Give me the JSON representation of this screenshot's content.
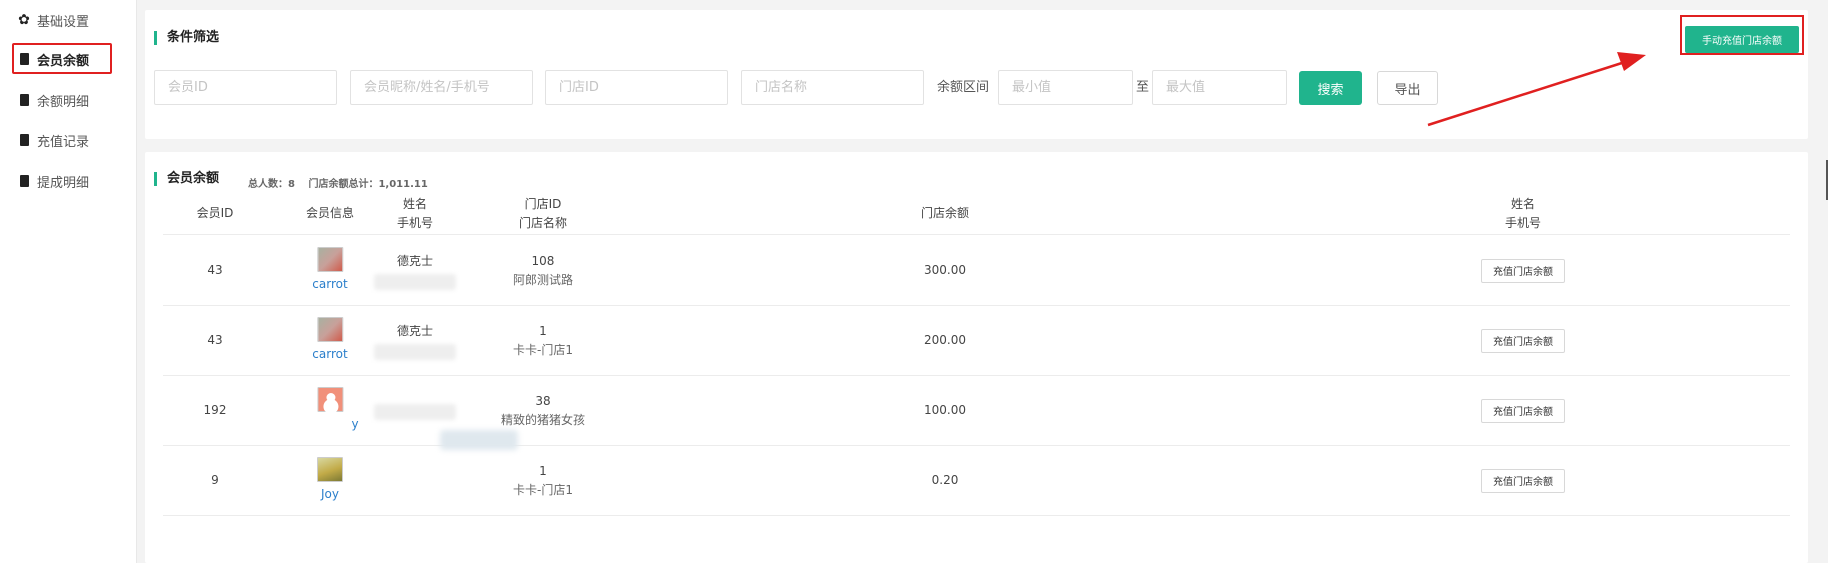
{
  "sidebar": {
    "items": [
      {
        "label": "基础设置",
        "icon": "gear-icon"
      },
      {
        "label": "会员余额",
        "icon": "clipboard-icon",
        "active": true
      },
      {
        "label": "余额明细",
        "icon": "clipboard-icon"
      },
      {
        "label": "充值记录",
        "icon": "clipboard-icon"
      },
      {
        "label": "提成明细",
        "icon": "clipboard-icon"
      }
    ]
  },
  "filter": {
    "title": "条件筛选",
    "member_id_placeholder": "会员ID",
    "member_name_placeholder": "会员昵称/姓名/手机号",
    "store_id_placeholder": "门店ID",
    "store_name_placeholder": "门店名称",
    "range_label": "余额区间",
    "min_placeholder": "最小值",
    "range_sep": "至",
    "max_placeholder": "最大值",
    "search_label": "搜索",
    "export_label": "导出",
    "manual_recharge_label": "手动充值门店余额"
  },
  "list": {
    "title": "会员余额",
    "total_count": "总人数：8",
    "total_balance": "门店余额总计：1,011.11",
    "columns": {
      "member_id": "会员ID",
      "member_info": "会员信息",
      "name_line1": "姓名",
      "name_line2": "手机号",
      "store_line1": "门店ID",
      "store_line2": "门店名称",
      "store_balance": "门店余额",
      "action_line1": "姓名",
      "action_line2": "手机号"
    },
    "rows": [
      {
        "member_id": "43",
        "username": "carrot",
        "name": "德克士",
        "store_id": "108",
        "store_name": "阿郎测试路",
        "balance": "300.00",
        "action": "充值门店余额"
      },
      {
        "member_id": "43",
        "username": "carrot",
        "name": "德克士",
        "store_id": "1",
        "store_name": "卡卡-门店1",
        "balance": "200.00",
        "action": "充值门店余额"
      },
      {
        "member_id": "192",
        "username": "y",
        "name": "",
        "store_id": "38",
        "store_name": "精致的猪猪女孩",
        "balance": "100.00",
        "action": "充值门店余额"
      },
      {
        "member_id": "9",
        "username": "Joy",
        "name": "",
        "store_id": "1",
        "store_name": "卡卡-门店1",
        "balance": "0.20",
        "action": "充值门店余额"
      }
    ]
  },
  "colors": {
    "accent": "#20b48d",
    "highlight": "#e02020",
    "link": "#2b7fcb"
  }
}
